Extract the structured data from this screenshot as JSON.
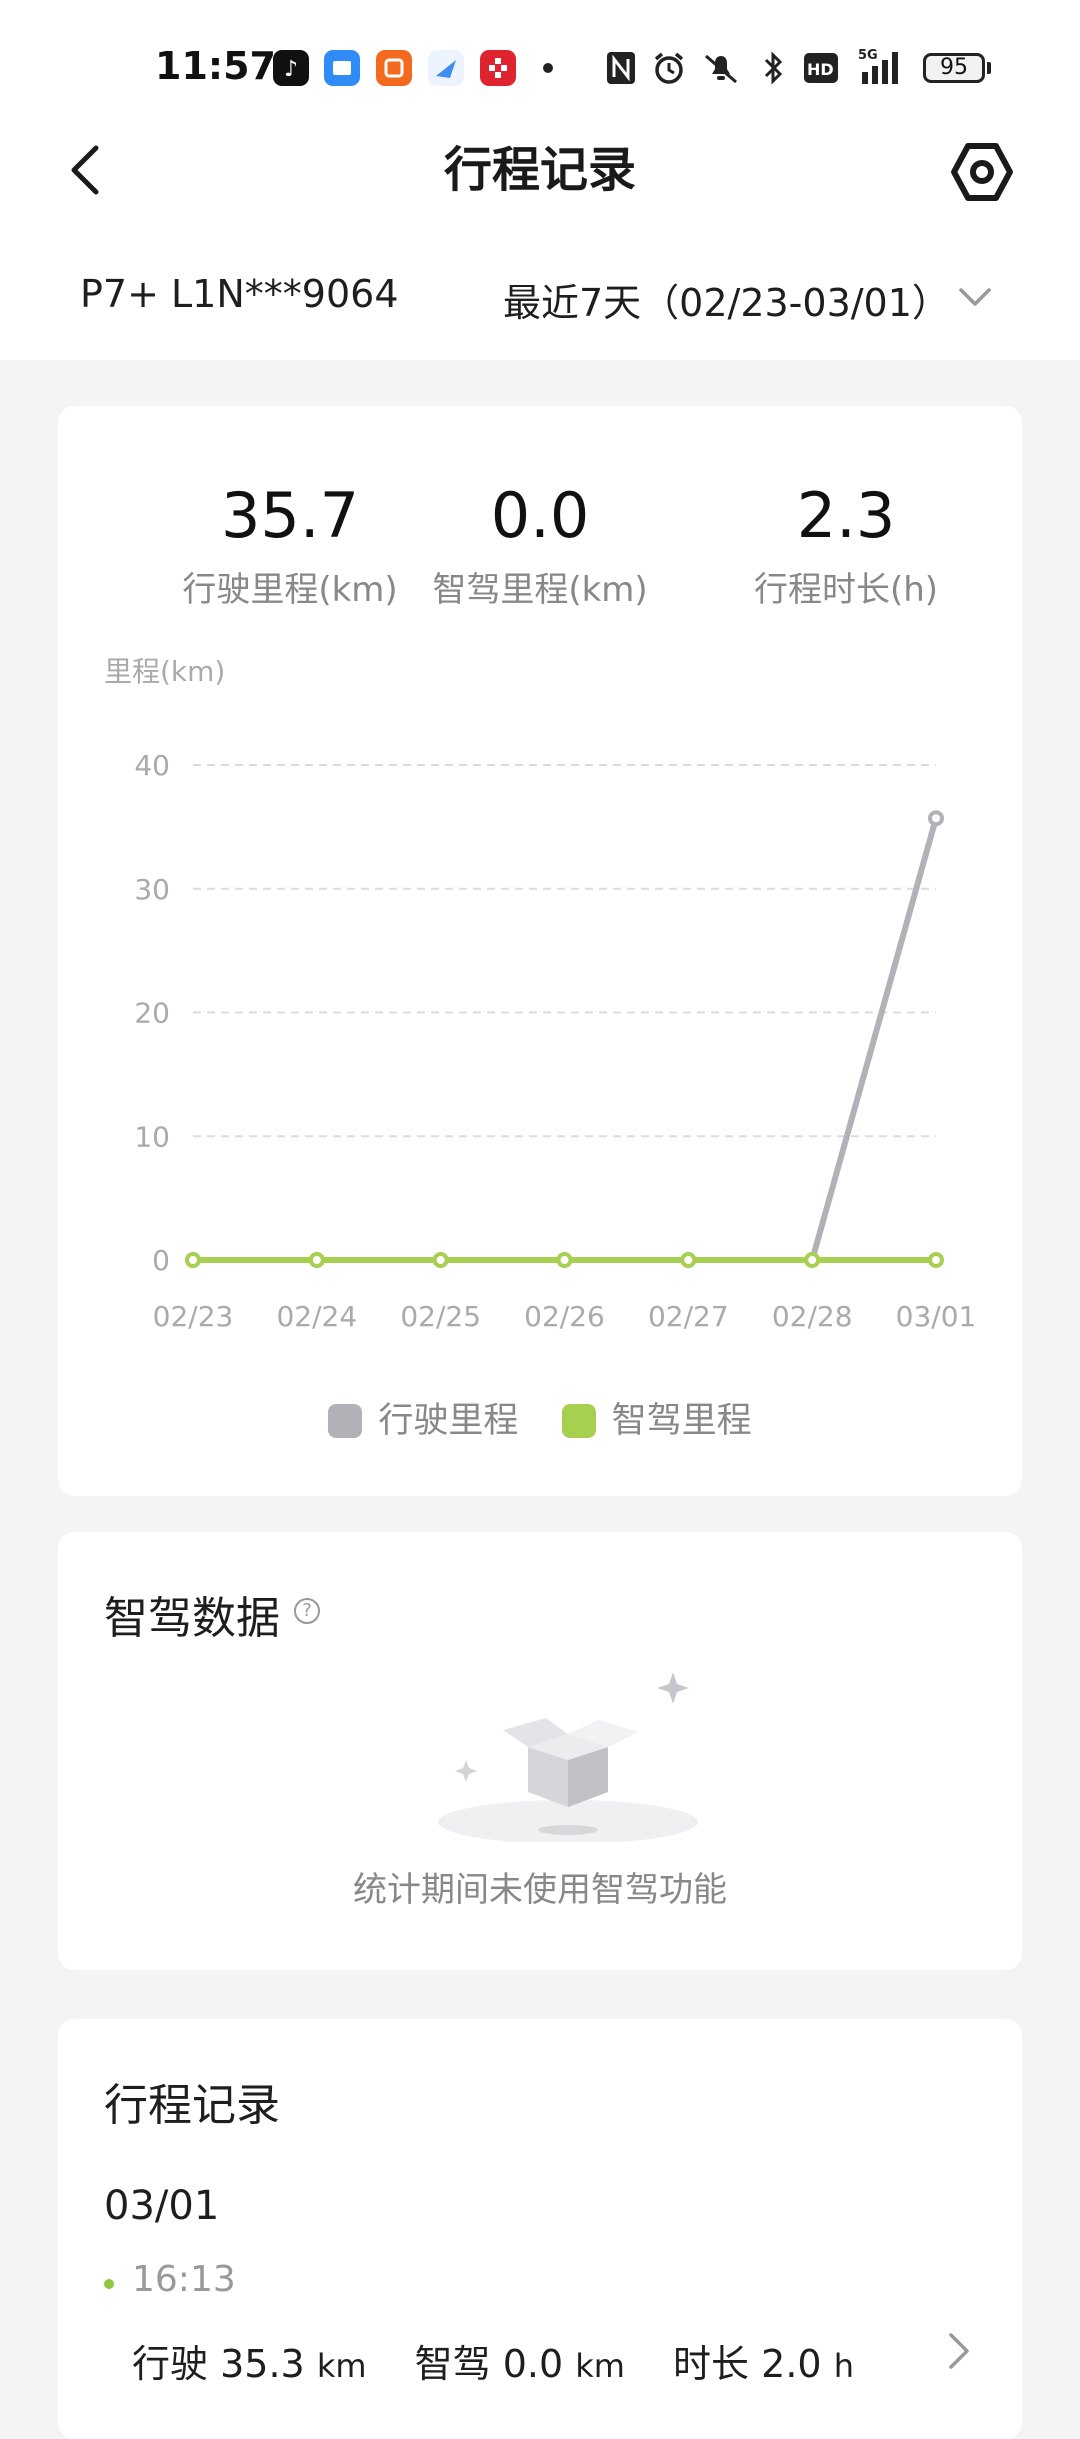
{
  "status_bar": {
    "time": "11:57",
    "app_icons": [
      {
        "name": "douyin-app-icon",
        "color": "#111111"
      },
      {
        "name": "files-app-icon",
        "color": "#2f8cf6"
      },
      {
        "name": "video-app-icon",
        "color": "#f36a1f"
      },
      {
        "name": "browser-app-icon",
        "color": "#3d8ef0"
      },
      {
        "name": "red-app-icon",
        "color": "#e0242f"
      }
    ],
    "battery": "95",
    "indicators": [
      "nfc-icon",
      "alarm-icon",
      "mute-icon",
      "bluetooth-icon",
      "hd-icon",
      "5g-signal-icon"
    ]
  },
  "header": {
    "title": "行程记录",
    "back_icon": "chevron-left-icon",
    "settings_icon": "hexagon-settings-icon"
  },
  "filter": {
    "vehicle": "P7+ L1N***9064",
    "date_range": "最近7天（02/23-03/01）",
    "dropdown_icon": "chevron-down-icon"
  },
  "summary": {
    "stats": [
      {
        "value": "35.7",
        "label": "行驶里程(km)"
      },
      {
        "value": "0.0",
        "label": "智驾里程(km)"
      },
      {
        "value": "2.3",
        "label": "行程时长(h)"
      }
    ]
  },
  "chart_data": {
    "type": "line",
    "ylabel": "里程(km)",
    "xlabel": "",
    "categories": [
      "02/23",
      "02/24",
      "02/25",
      "02/26",
      "02/27",
      "02/28",
      "03/01"
    ],
    "ylim": [
      0,
      40
    ],
    "yticks": [
      0,
      10,
      20,
      30,
      40
    ],
    "grid": true,
    "legend_position": "bottom-center",
    "series": [
      {
        "name": "行驶里程",
        "color": "#b0b2b8",
        "values": [
          0,
          0,
          0,
          0,
          0,
          0,
          35.7
        ]
      },
      {
        "name": "智驾里程",
        "color": "#a8d050",
        "values": [
          0,
          0,
          0,
          0,
          0,
          0,
          0
        ]
      }
    ]
  },
  "smart_driving": {
    "title": "智驾数据",
    "help_icon": "question-circle-icon",
    "empty_text": "统计期间未使用智驾功能"
  },
  "trips": {
    "title": "行程记录",
    "date": "03/01",
    "items": [
      {
        "time": "16:13",
        "drive_label": "行驶",
        "drive_value": "35.3",
        "drive_unit": "km",
        "smart_label": "智驾",
        "smart_value": "0.0",
        "smart_unit": "km",
        "duration_label": "时长",
        "duration_value": "2.0",
        "duration_unit": "h"
      }
    ]
  }
}
